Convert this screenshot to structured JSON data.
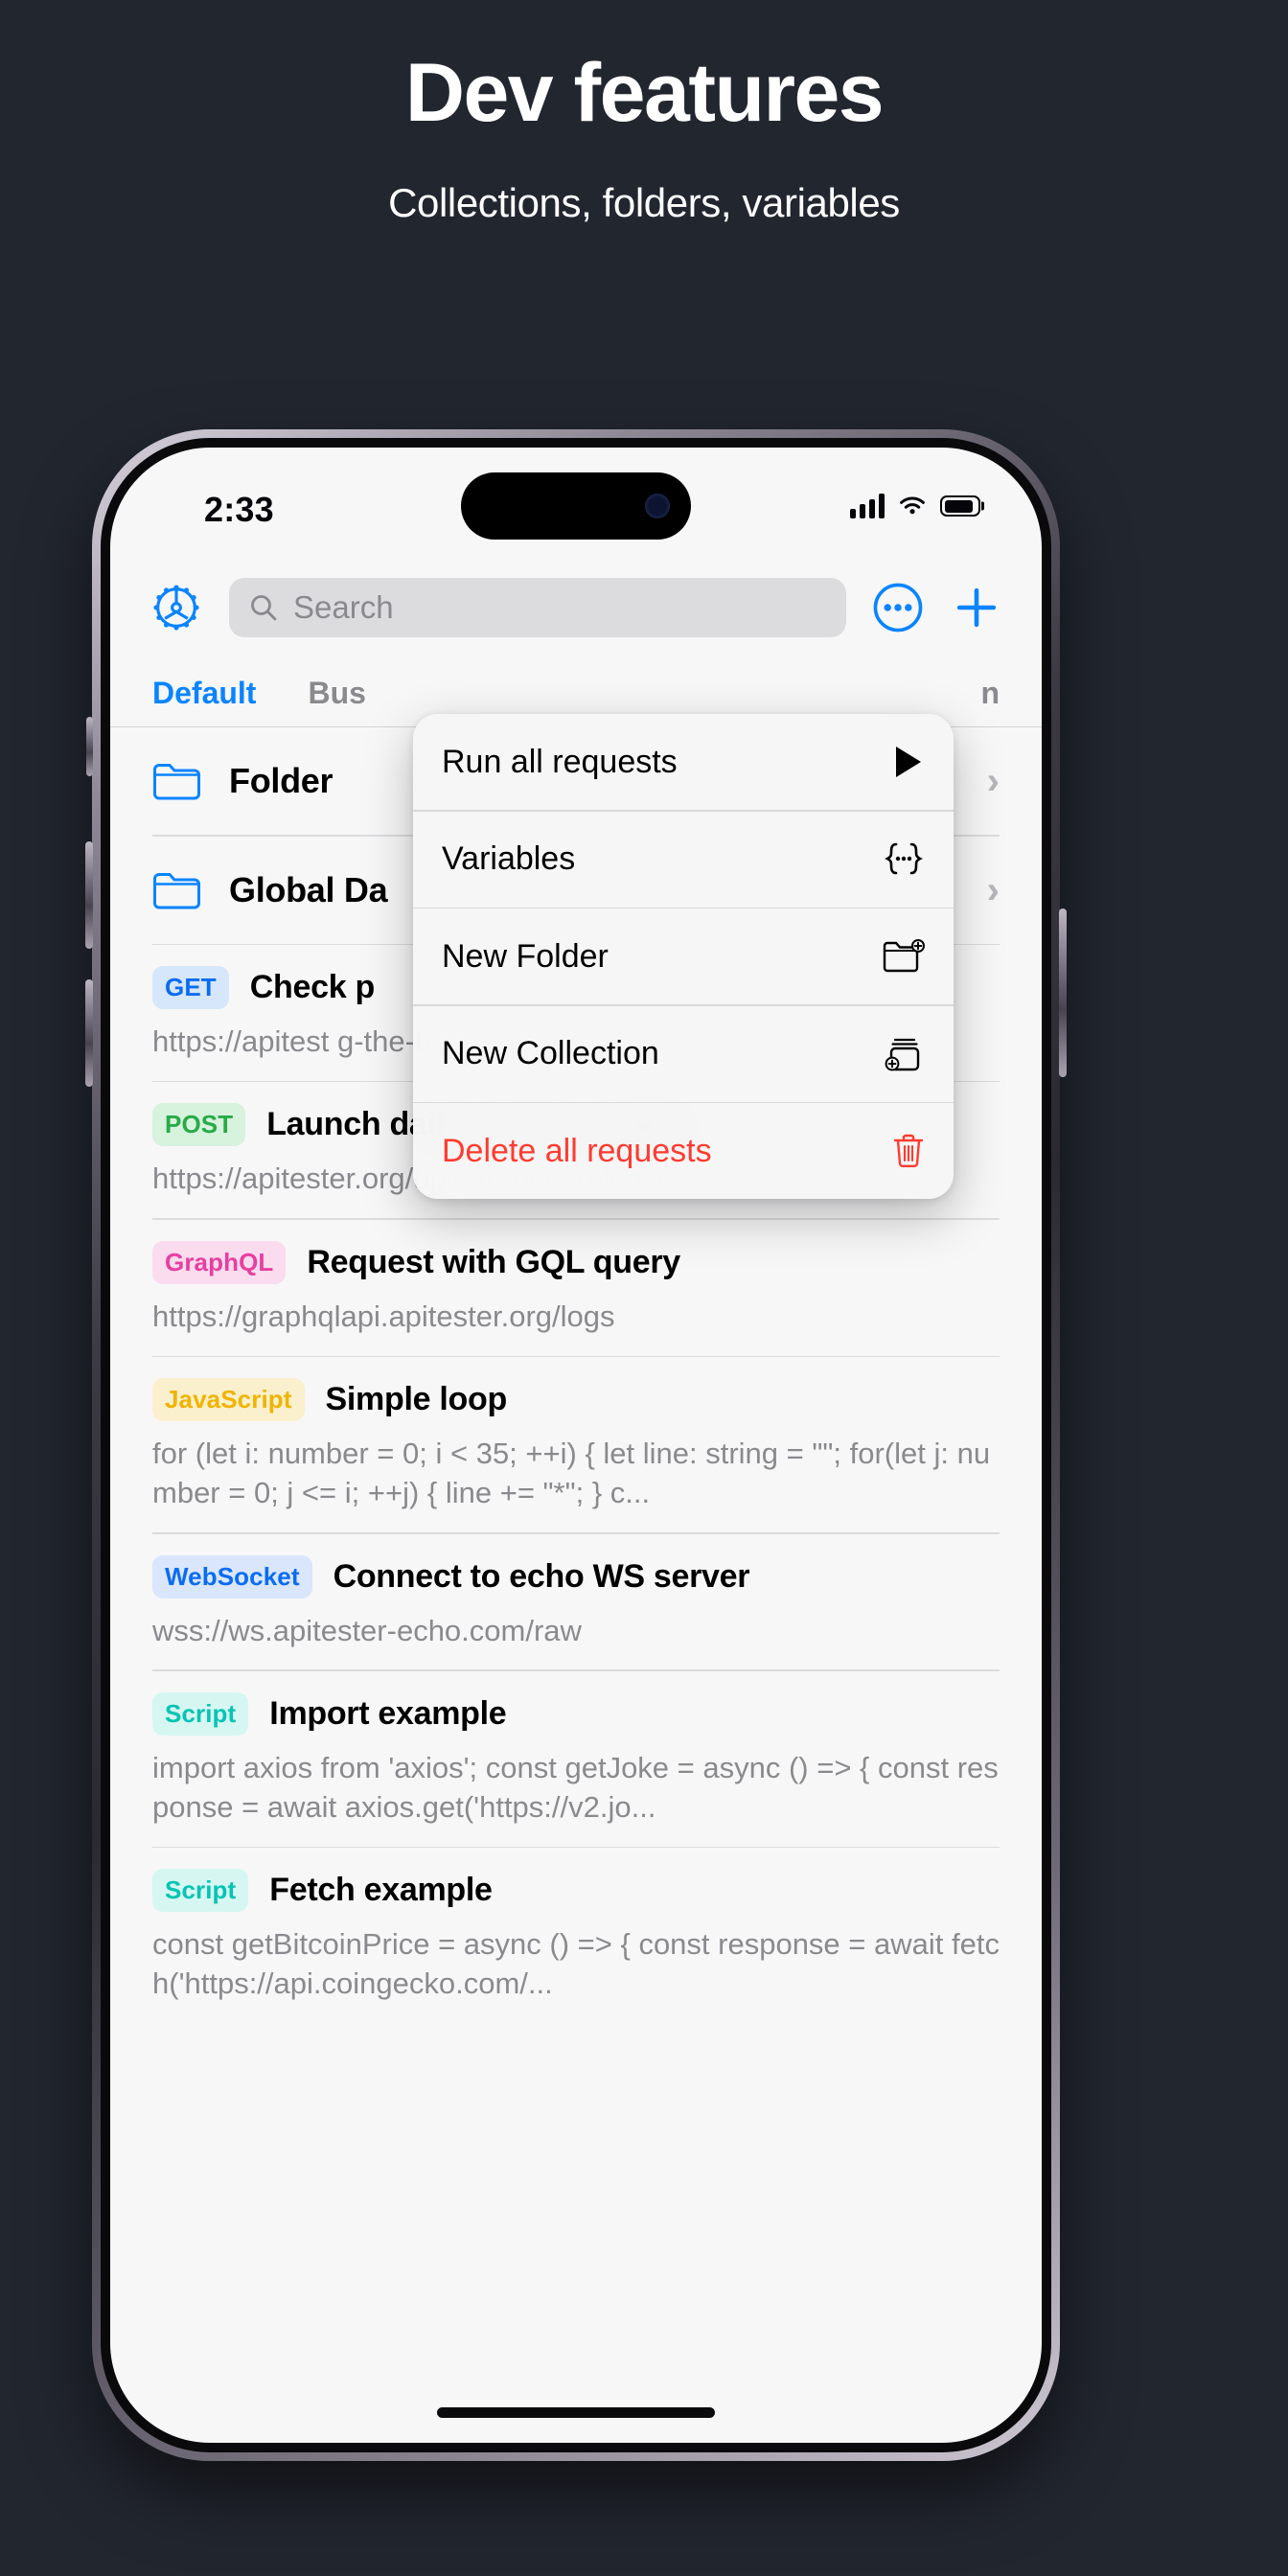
{
  "promo": {
    "title": "Dev features",
    "subtitle": "Collections, folders, variables"
  },
  "status_bar": {
    "time": "2:33",
    "signal_icon": "cellular-signal-icon",
    "wifi_icon": "wifi-icon",
    "battery_icon": "battery-icon"
  },
  "toolbar": {
    "settings_icon": "gear-icon",
    "search_placeholder": "Search",
    "search_value": "",
    "search_icon": "search-icon",
    "more_icon": "ellipsis-circle-icon",
    "add_icon": "plus-icon"
  },
  "tabs": [
    {
      "label": "Default",
      "active": true
    },
    {
      "label": "Bus",
      "active": false
    },
    {
      "label": "n",
      "active": false
    }
  ],
  "context_menu": {
    "items": [
      {
        "label": "Run all requests",
        "icon": "play-icon",
        "destructive": false
      },
      {
        "label": "Variables",
        "icon": "variables-braces-icon",
        "destructive": false
      },
      {
        "label": "New Folder",
        "icon": "folder-plus-icon",
        "destructive": false
      },
      {
        "label": "New Collection",
        "icon": "collection-plus-icon",
        "destructive": false
      },
      {
        "label": "Delete all requests",
        "icon": "trash-icon",
        "destructive": true
      }
    ]
  },
  "list": {
    "folders": [
      {
        "name": "Folder",
        "icon": "folder-icon",
        "chevron": "›"
      },
      {
        "name": "Global Da",
        "icon": "folder-icon",
        "chevron": "›"
      }
    ],
    "requests": [
      {
        "badge": "GET",
        "badge_bg": "#d6e7fb",
        "badge_fg": "#0a6cf1",
        "title": "Check p",
        "url": "https://apitest                      g-the-best-app-for-developers/get?"
      },
      {
        "badge": "POST",
        "badge_bg": "#d7f2dd",
        "badge_fg": "#27ab48",
        "title": "Launch daily system update",
        "url": "https://apitester.org/upload-new-release"
      },
      {
        "badge": "GraphQL",
        "badge_bg": "#fadcee",
        "badge_fg": "#e83ea0",
        "title": "Request with GQL query",
        "url": "https://graphqlapi.apitester.org/logs"
      },
      {
        "badge": "JavaScript",
        "badge_bg": "#faf0cd",
        "badge_fg": "#f0b400",
        "title": "Simple loop",
        "url": "for (let i: number = 0; i < 35; ++i) { let line: string = \"\"; for(let j: number = 0; j <= i; ++j) { line += \"*\"; } c..."
      },
      {
        "badge": "WebSocket",
        "badge_bg": "#d9e6fb",
        "badge_fg": "#0a6cf1",
        "title": "Connect to echo WS server",
        "url": "wss://ws.apitester-echo.com/raw"
      },
      {
        "badge": "Script",
        "badge_bg": "#d6f7f1",
        "badge_fg": "#06c4b4",
        "title": "Import example",
        "url": "import axios from 'axios'; const getJoke = async () => { const response = await axios.get('https://v2.jo..."
      },
      {
        "badge": "Script",
        "badge_bg": "#d6f7f1",
        "badge_fg": "#06c4b4",
        "title": "Fetch example",
        "url": "const getBitcoinPrice = async () => { const response = await fetch('https://api.coingecko.com/..."
      }
    ]
  },
  "colors": {
    "page_bg": "#22262f",
    "accent_blue": "#0a84ff",
    "destructive_red": "#ff3b30",
    "screen_bg": "#f7f7f8"
  }
}
